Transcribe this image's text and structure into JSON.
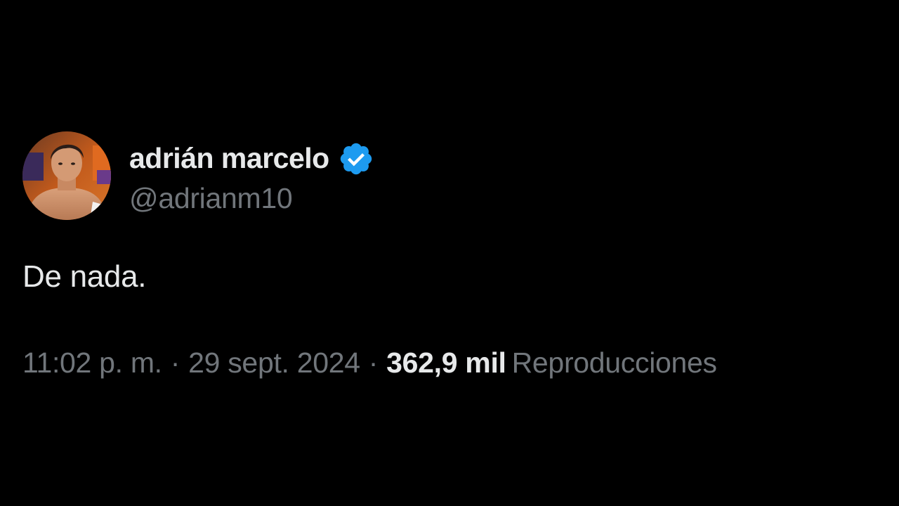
{
  "user": {
    "display_name": "adrián marcelo",
    "handle": "@adrianm10",
    "verified_icon": "verified-badge-icon",
    "verified_color": "#1d9bf0"
  },
  "tweet": {
    "text": "De nada."
  },
  "meta": {
    "time": "11:02 p. m.",
    "separator": "·",
    "date": "29 sept. 2024",
    "views_count": "362,9 mil",
    "views_label": "Reproducciones"
  },
  "colors": {
    "background": "#000000",
    "primary_text": "#e7e9ea",
    "secondary_text": "#71767b"
  }
}
